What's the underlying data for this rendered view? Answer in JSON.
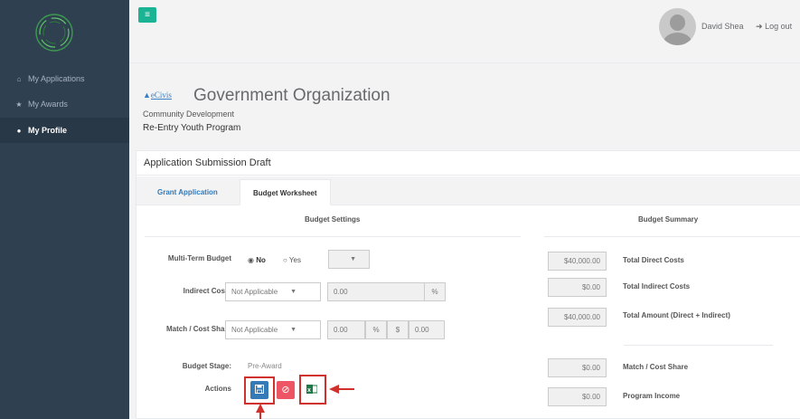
{
  "colors": {
    "sidebar": "#2f4050",
    "accent": "#1ab394",
    "primary": "#337ab7",
    "danger": "#ed5565",
    "highlight": "#d0312d"
  },
  "sidebar": {
    "logo_icon": "ring-logo",
    "items": [
      {
        "label": "My Applications",
        "icon": "home-icon"
      },
      {
        "label": "My Awards",
        "icon": "trophy-icon"
      },
      {
        "label": "My Profile",
        "icon": "user-icon",
        "active": true
      }
    ]
  },
  "topbar": {
    "menu_icon": "hamburger-icon",
    "user_name": "David Shea",
    "logout_label": "Log out"
  },
  "org": {
    "logo_text": "eCivis",
    "name": "Government Organization",
    "department": "Community Development",
    "program": "Re-Entry Youth Program"
  },
  "panel": {
    "title": "Application Submission Draft",
    "tabs": [
      {
        "label": "Grant Application",
        "active": false
      },
      {
        "label": "Budget Worksheet",
        "active": true
      }
    ]
  },
  "settings": {
    "title": "Budget Settings",
    "multi_term_label": "Multi-Term Budget",
    "radio_no": "No",
    "radio_yes": "Yes",
    "indirect_label": "Indirect Costs",
    "indirect_select": "Not Applicable",
    "indirect_value": "0.00",
    "percent": "%",
    "match_label": "Match / Cost Share",
    "match_select": "Not Applicable",
    "match_pct": "0.00",
    "dollar": "$",
    "match_amount": "0.00",
    "stage_label": "Budget Stage:",
    "stage_value": "Pre-Award",
    "actions_label": "Actions"
  },
  "summary": {
    "title": "Budget Summary",
    "rows": [
      {
        "value": "$40,000.00",
        "label": "Total Direct Costs"
      },
      {
        "value": "$0.00",
        "label": "Total Indirect Costs"
      },
      {
        "value": "$40,000.00",
        "label": "Total Amount (Direct + Indirect)"
      },
      {
        "value": "$0.00",
        "label": "Match / Cost Share"
      },
      {
        "value": "$0.00",
        "label": "Program Income"
      }
    ]
  }
}
